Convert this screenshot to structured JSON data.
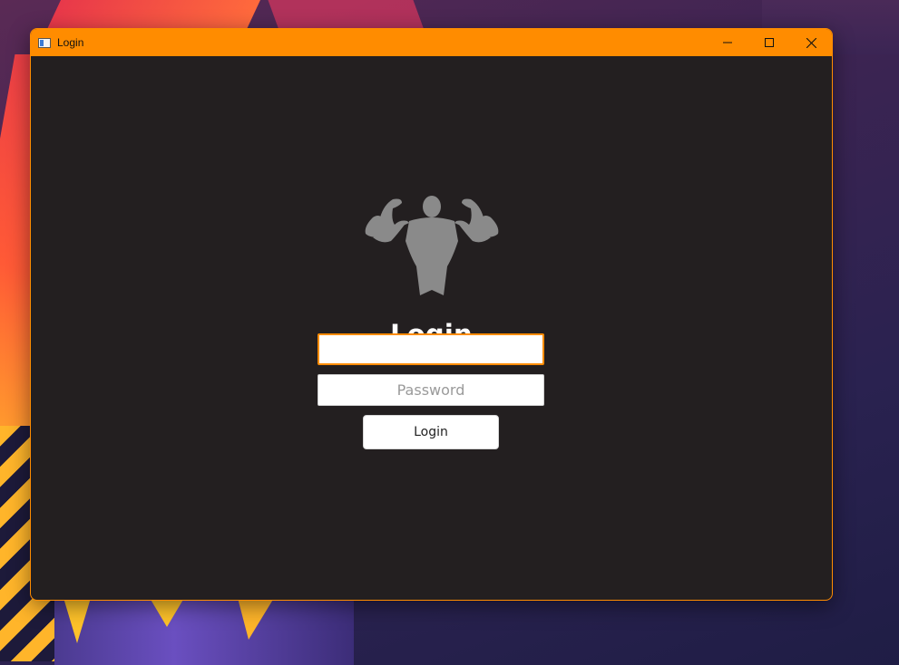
{
  "window": {
    "title": "Login",
    "accent_color": "#ff8c00",
    "background_color": "#231f20",
    "controls": [
      {
        "name": "minimize",
        "icon": "minimize-icon"
      },
      {
        "name": "maximize",
        "icon": "maximize-icon"
      },
      {
        "name": "close",
        "icon": "close-icon"
      }
    ]
  },
  "login": {
    "logo_icon": "bodybuilder-silhouette-icon",
    "heading": "Login",
    "username": {
      "value": "",
      "placeholder": ""
    },
    "password": {
      "value": "",
      "placeholder": "Password"
    },
    "submit_label": "Login"
  }
}
